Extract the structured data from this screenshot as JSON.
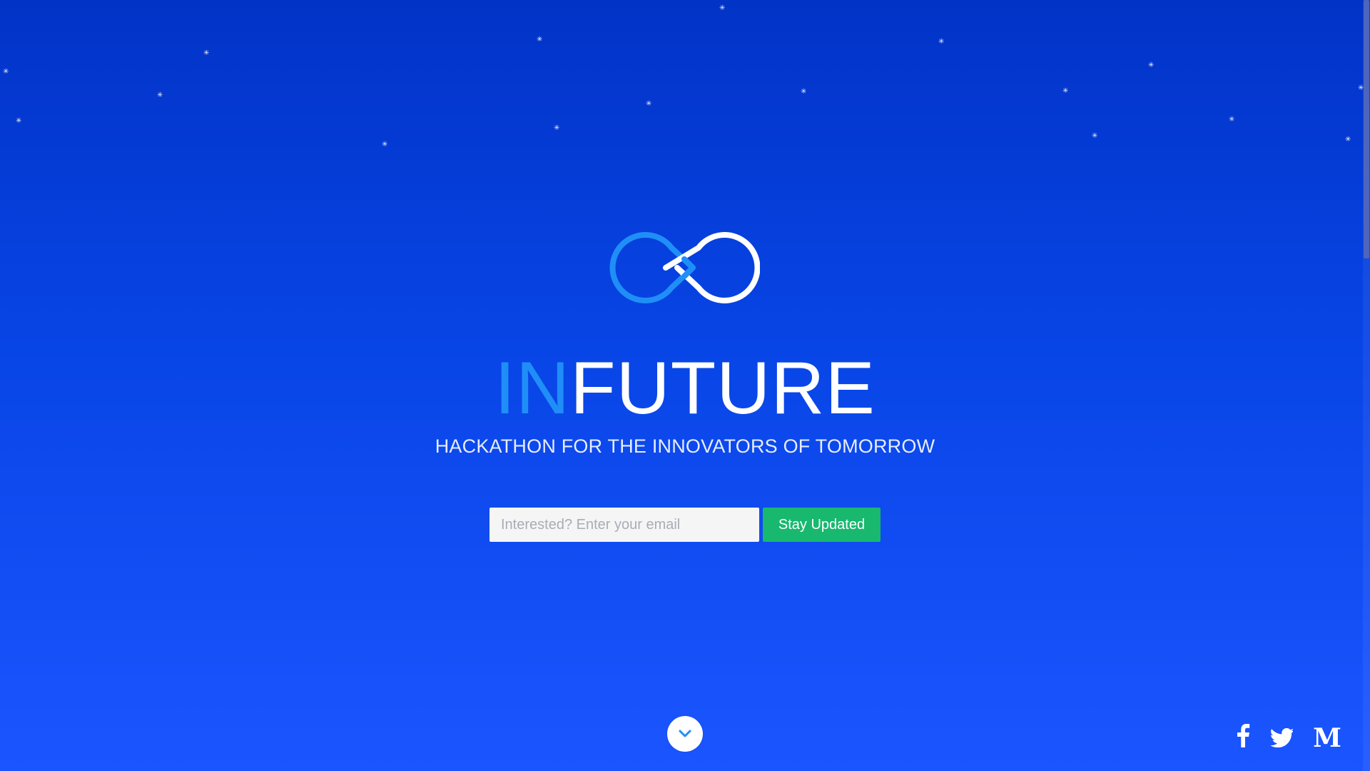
{
  "background_colors": {
    "top": "#0233c7",
    "bottom": "#1b55ff"
  },
  "logo": {
    "name": "infinity-code-logo",
    "colors": [
      "#1f8ff7",
      "#ffffff"
    ]
  },
  "title": {
    "prefix": "IN",
    "suffix": "FUTURE",
    "prefix_color": "#1f8ff7",
    "suffix_color": "#ffffff"
  },
  "subtitle": "HACKATHON FOR THE INNOVATORS OF TOMORROW",
  "signup": {
    "email_placeholder": "Interested? Enter your email",
    "button_label": "Stay Updated",
    "button_color": "#18b86f"
  },
  "scroll_down": {
    "icon": "chevron-down-icon",
    "icon_color": "#1f8ff7"
  },
  "social": [
    {
      "name": "facebook",
      "icon": "facebook-icon"
    },
    {
      "name": "twitter",
      "icon": "twitter-icon"
    },
    {
      "name": "medium",
      "icon": "medium-icon",
      "glyph": "M"
    }
  ],
  "stars_icon": "snowflake-icon"
}
